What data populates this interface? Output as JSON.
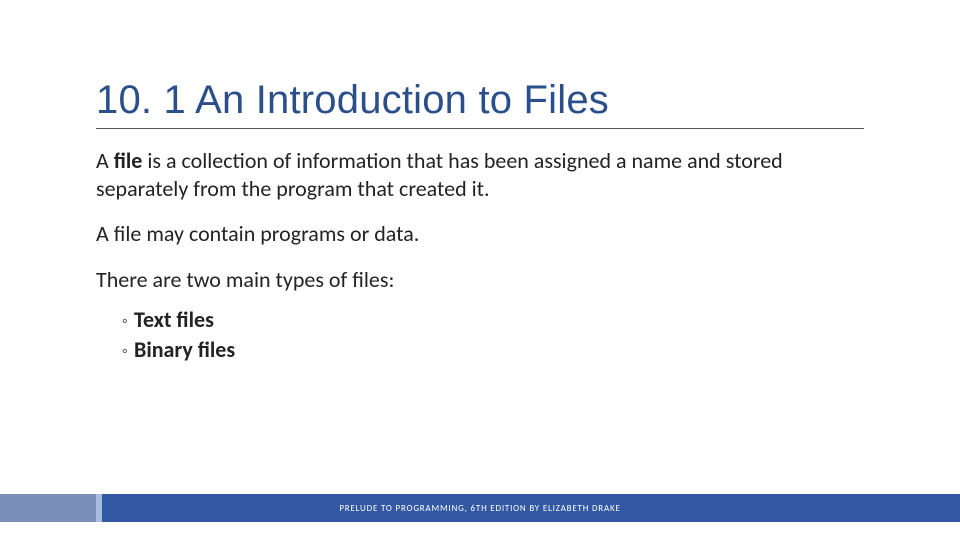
{
  "slide": {
    "title": "10. 1 An Introduction to Files",
    "paragraphs": [
      {
        "runs": [
          {
            "text": "A ",
            "bold": false
          },
          {
            "text": "file",
            "bold": true
          },
          {
            "text": " is a collection of information that has been assigned a name and stored separately from the program that created it.",
            "bold": false
          }
        ]
      },
      {
        "runs": [
          {
            "text": "A file may contain programs or data.",
            "bold": false
          }
        ]
      },
      {
        "runs": [
          {
            "text": "There are two main types of files:",
            "bold": false
          }
        ]
      }
    ],
    "sublist": [
      "Text files",
      "Binary files"
    ],
    "footer": "PRELUDE TO PROGRAMMING, 6TH EDITION BY ELIZABETH DRAKE"
  }
}
